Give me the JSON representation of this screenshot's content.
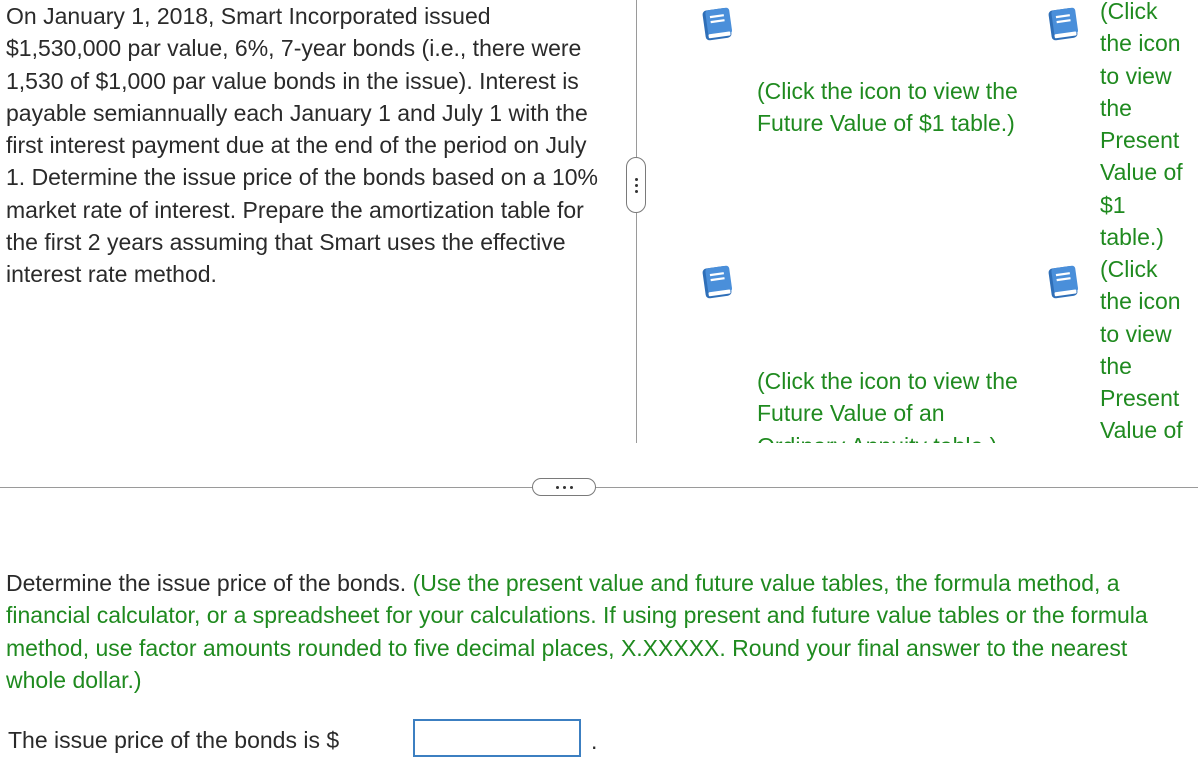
{
  "problem": {
    "text": "On January 1, 2018, Smart Incorporated issued $1,530,000 par value, 6%, 7-year bonds (i.e., there were 1,530 of $1,000 par value bonds in the issue). Interest is payable semiannually each January 1 and July 1 with the first interest payment due at the end of the period on July 1. Determine the issue price of the bonds based on a 10% market rate of interest. Prepare the amortization table for the first 2 years assuming that Smart uses the effective interest rate method."
  },
  "tables": {
    "fv1": {
      "icon": "book-icon",
      "label": "(Click the icon to view the Future Value of $1 table.)"
    },
    "pv1": {
      "icon": "book-icon",
      "label": "(Click the icon to view the Present Value of $1 table.)"
    },
    "fva": {
      "icon": "book-icon",
      "label": "(Click the icon to view the Future Value of an Ordinary Annuity table.)"
    },
    "pva": {
      "icon": "book-icon",
      "label": "(Click the icon to view the Present Value of"
    }
  },
  "question": {
    "prompt": "Determine the issue price of the bonds.",
    "instruction": "(Use the present value and future value tables, the formula method, a financial calculator, or a spreadsheet for your calculations. If using present and future value tables or the formula method, use factor amounts rounded to five decimal places, X.XXXXX. Round your final answer to the nearest whole dollar.)"
  },
  "answer": {
    "label": "The issue price of the bonds is $",
    "value": "",
    "suffix": "."
  },
  "colors": {
    "accent_green": "#1f8a1f",
    "book_blue": "#3a7cc7",
    "input_border": "#3c7fc1"
  }
}
